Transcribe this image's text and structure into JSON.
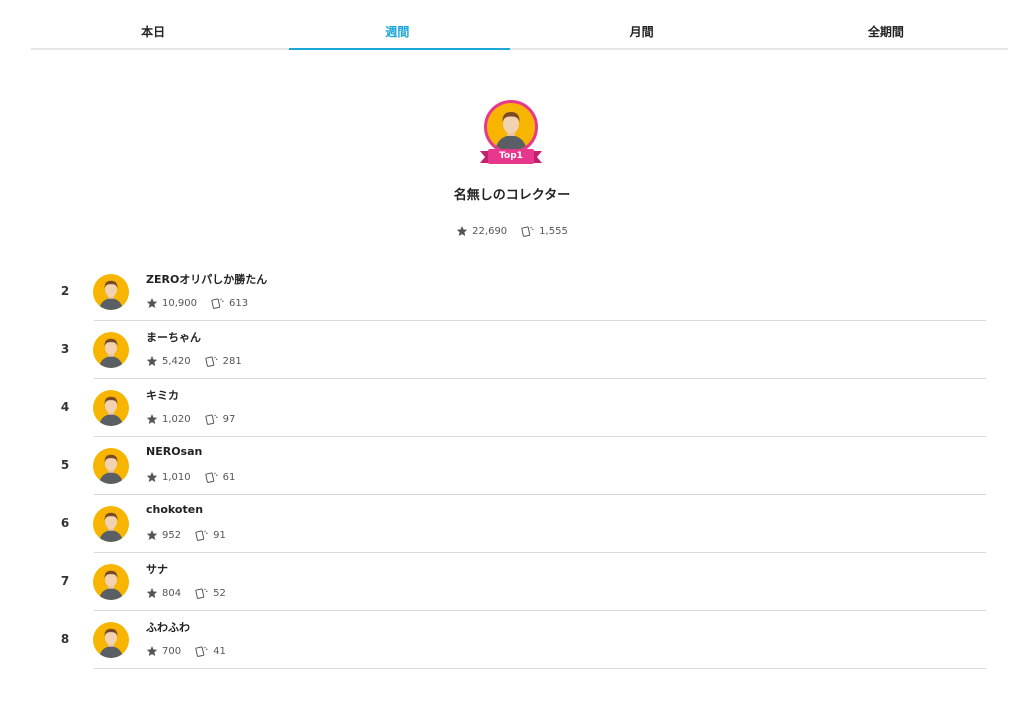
{
  "tabs": [
    {
      "label": "本日",
      "active": false
    },
    {
      "label": "週間",
      "active": true
    },
    {
      "label": "月間",
      "active": false
    },
    {
      "label": "全期間",
      "active": false
    }
  ],
  "colors": {
    "accent": "#1aa6d8",
    "avatar_bg": "#f7b500",
    "top1_ribbon": "#e8388e"
  },
  "top1": {
    "badge": "Top1",
    "name": "名無しのコレクター",
    "stars": "22,690",
    "cards": "1,555"
  },
  "icons": {
    "star": "star-icon",
    "cards": "cards-icon",
    "avatar": "avatar-icon"
  },
  "ranking": [
    {
      "rank": "2",
      "name": "ZEROオリパしか勝たん",
      "stars": "10,900",
      "cards": "613"
    },
    {
      "rank": "3",
      "name": "まーちゃん",
      "stars": "5,420",
      "cards": "281"
    },
    {
      "rank": "4",
      "name": "キミカ",
      "stars": "1,020",
      "cards": "97"
    },
    {
      "rank": "5",
      "name": "NEROsan",
      "stars": "1,010",
      "cards": "61"
    },
    {
      "rank": "6",
      "name": "chokoten",
      "stars": "952",
      "cards": "91"
    },
    {
      "rank": "7",
      "name": "サナ",
      "stars": "804",
      "cards": "52"
    },
    {
      "rank": "8",
      "name": "ふわふわ",
      "stars": "700",
      "cards": "41"
    }
  ]
}
